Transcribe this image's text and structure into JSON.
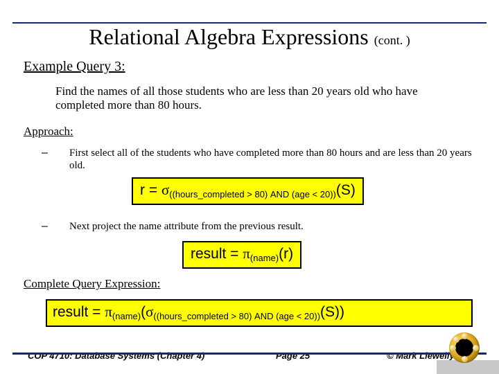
{
  "title": {
    "main": "Relational Algebra Expressions",
    "cont": "(cont. )"
  },
  "example_heading": "Example Query 3:",
  "query_text": "Find the names of all those students who are less than 20 years old who have completed more than 80 hours.",
  "approach_heading": "Approach:",
  "steps": [
    {
      "dash": "–",
      "text": "First select all of the students who have completed more than 80 hours and are less than 20 years old."
    },
    {
      "dash": "–",
      "text": "Next project the name attribute from the previous result."
    }
  ],
  "formula1": {
    "lhs": "r = ",
    "sigma": "σ",
    "sub": "((hours_completed > 80) AND (age < 20))",
    "tail": "(S)"
  },
  "formula2": {
    "lhs": "result = ",
    "pi": "π",
    "sub": "(name)",
    "tail": "(r)"
  },
  "complete_heading": "Complete Query Expression:",
  "formula3": {
    "lhs": "result = ",
    "pi": "π",
    "sub1": "(name)",
    "mid": "(",
    "sigma": "σ",
    "sub2": "((hours_completed > 80) AND (age < 20))",
    "tail": "(S))"
  },
  "footer": {
    "left": "COP 4710: Database Systems  (Chapter 4)",
    "center": "Page 25",
    "right": "© Mark Llewellyn"
  }
}
